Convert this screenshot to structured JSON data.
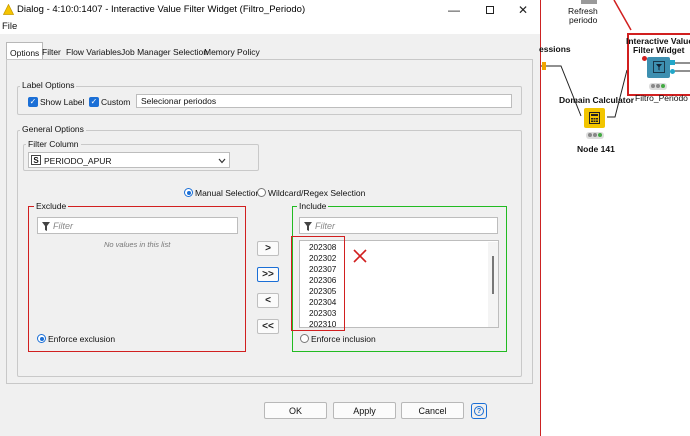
{
  "window": {
    "title": "Dialog - 4:10:0:1407 - Interactive Value Filter Widget (Filtro_Periodo)"
  },
  "menu": {
    "file": "File"
  },
  "tabs": [
    "Options",
    "Filter",
    "Flow Variables",
    "Job Manager Selection",
    "Memory Policy"
  ],
  "label_options": {
    "group_label": "Label Options",
    "show_label": "Show Label",
    "custom": "Custom",
    "label_value": "Selecionar periodos"
  },
  "general_options": {
    "group_label": "General Options",
    "filter_column_label": "Filter Column",
    "column_type_badge": "S",
    "column_value": "PERIODO_APUR",
    "manual_selection": "Manual Selection",
    "wildcard_selection": "Wildcard/Regex Selection"
  },
  "exclude": {
    "label": "Exclude",
    "filter_placeholder": "Filter",
    "empty_text": "No values in this list",
    "enforce": "Enforce exclusion"
  },
  "include": {
    "label": "Include",
    "filter_placeholder": "Filter",
    "items": [
      "202308",
      "202302",
      "202307",
      "202306",
      "202305",
      "202304",
      "202303",
      "202310"
    ],
    "enforce": "Enforce inclusion"
  },
  "move_buttons": [
    ">",
    ">>",
    "<",
    "<<"
  ],
  "buttons": {
    "ok": "OK",
    "apply": "Apply",
    "cancel": "Cancel",
    "help": "?"
  },
  "workflow": {
    "refresh_line1": "Refresh",
    "refresh_line2": "periodo",
    "sessions_fragment": "essions",
    "domain_calculator": "Domain Calculator",
    "node_141": "Node 141",
    "widget_line1": "Interactive Value",
    "widget_line2": "Filter Widget",
    "widget_caption": "Filtro_Periodo"
  },
  "colors": {
    "accent": "#1b6fd6",
    "annotation_red": "#d11f1f",
    "include_green": "#22bb22",
    "domain_node": "#f2c500",
    "widget_node": "#3d8fb0"
  }
}
